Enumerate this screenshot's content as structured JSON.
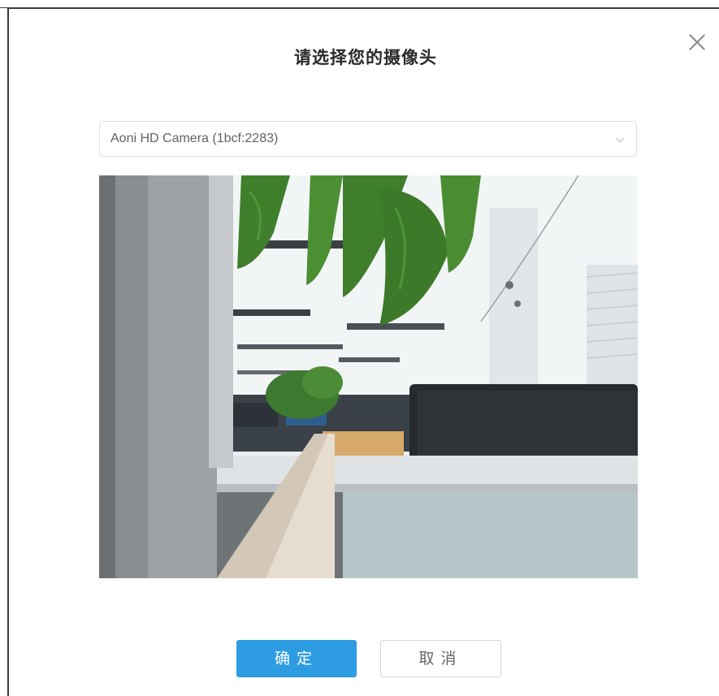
{
  "dialog": {
    "title": "请选择您的摄像头",
    "close_icon": "close-icon"
  },
  "camera_select": {
    "selected": "Aoni HD Camera (1bcf:2283)",
    "chevron_icon": "chevron-down-icon"
  },
  "buttons": {
    "confirm_label": "确定",
    "cancel_label": "取消"
  },
  "colors": {
    "primary": "#2d9ce2",
    "border": "#dcdfe6",
    "title": "#2a2a2a"
  }
}
